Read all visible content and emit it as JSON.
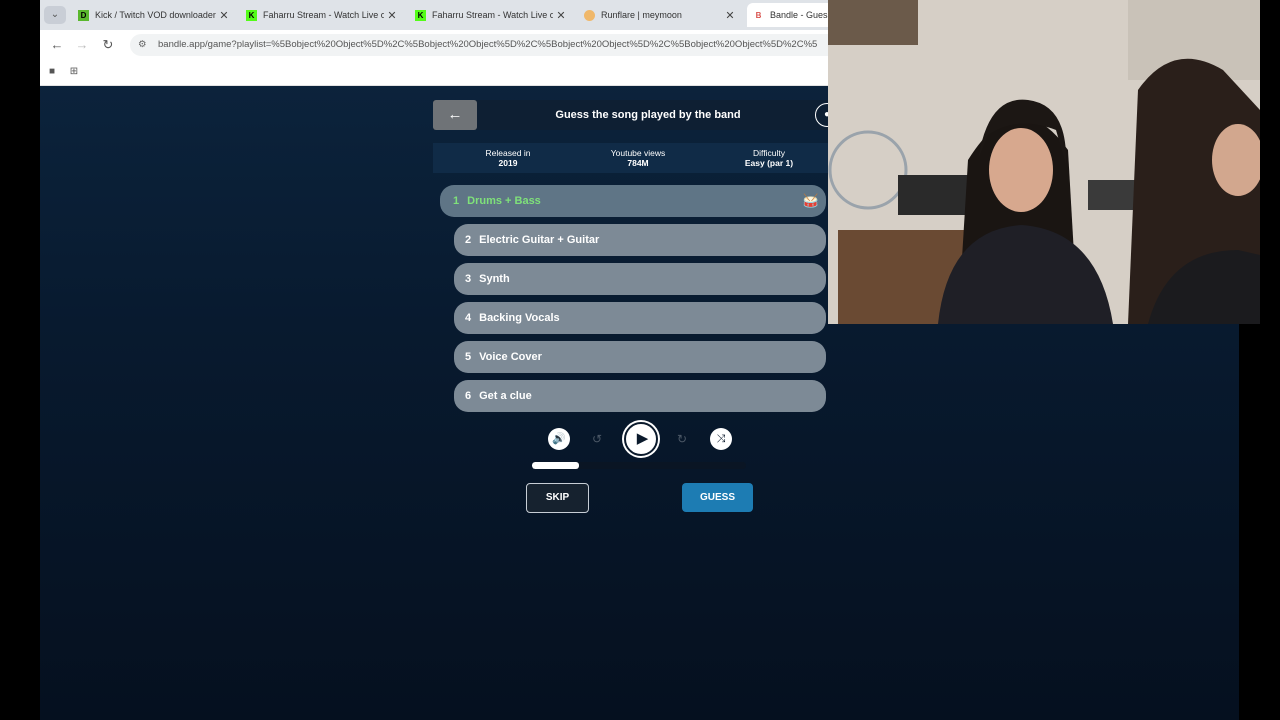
{
  "browser": {
    "tabs": [
      {
        "favicon": "D",
        "favicon_color": "#5ab82e",
        "title": "Kick / Twitch VOD downloader"
      },
      {
        "favicon": "K",
        "favicon_color": "#53fc18",
        "title": "Faharru Stream - Watch Live on"
      },
      {
        "favicon": "K",
        "favicon_color": "#53fc18",
        "title": "Faharru Stream - Watch Live on"
      },
      {
        "favicon": "",
        "favicon_color": "#f0b86a",
        "title": "Runflare | meymoon"
      },
      {
        "favicon": "B",
        "favicon_color": "#d9534f",
        "title": "Bandle - Guess"
      }
    ],
    "url": "bandle.app/game?playlist=%5Bobject%20Object%5D%2C%5Bobject%20Object%5D%2C%5Bobject%20Object%5D%2C%5Bobject%20Object%5D%2C%5"
  },
  "game": {
    "title": "Guess the song played by the band",
    "stats": [
      {
        "label": "Released in",
        "value": "2019"
      },
      {
        "label": "Youtube views",
        "value": "784M"
      },
      {
        "label": "Difficulty",
        "value": "Easy (par 1)"
      }
    ],
    "clues": [
      {
        "num": "1",
        "label": "Drums + Bass",
        "active": true
      },
      {
        "num": "2",
        "label": "Electric Guitar + Guitar"
      },
      {
        "num": "3",
        "label": "Synth"
      },
      {
        "num": "4",
        "label": "Backing Vocals"
      },
      {
        "num": "5",
        "label": "Voice Cover"
      },
      {
        "num": "6",
        "label": "Get a clue"
      }
    ],
    "progress_fraction": 0.22,
    "skip_label": "SKIP",
    "guess_label": "GUESS"
  },
  "colors": {
    "active_clue_text": "#7fe17a",
    "guess_button": "#1d7cb3"
  },
  "icons": {
    "back": "arrow-left-icon",
    "profile": "user-icon",
    "drum": "drum-kit-icon",
    "volume": "volume-icon",
    "rewind": "rewind-5-icon",
    "play": "play-icon",
    "forward": "forward-5-icon",
    "shuffle": "shuffle-off-icon"
  }
}
